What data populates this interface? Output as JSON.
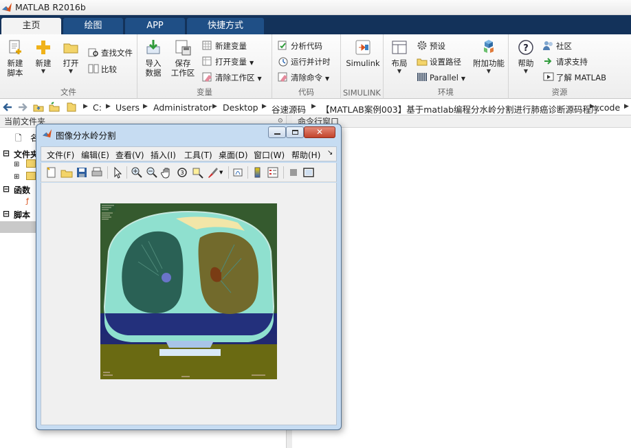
{
  "app": {
    "title": "MATLAB R2016b"
  },
  "tabs": [
    {
      "label": "主页",
      "active": true
    },
    {
      "label": "绘图"
    },
    {
      "label": "APP"
    },
    {
      "label": "快捷方式"
    }
  ],
  "ribbon": {
    "file": {
      "label": "文件",
      "new_script": "新建\n脚本",
      "new": "新建",
      "open": "打开",
      "find_files": "查找文件",
      "compare": "比较"
    },
    "variable": {
      "label": "变量",
      "import": "导入\n数据",
      "save_workspace": "保存\n工作区",
      "new_variable": "新建变量",
      "open_variable": "打开变量",
      "clear_workspace": "清除工作区"
    },
    "code": {
      "label": "代码",
      "analyze": "分析代码",
      "run_time": "运行并计时",
      "clear_commands": "清除命令"
    },
    "simulink": {
      "label": "SIMULINK",
      "simulink": "Simulink"
    },
    "environment": {
      "label": "环境",
      "layout": "布局",
      "preferences": "预设",
      "set_path": "设置路径",
      "parallel": "Parallel",
      "addons": "附加功能"
    },
    "resources": {
      "label": "资源",
      "help": "帮助",
      "community": "社区",
      "support": "请求支持",
      "learn": "了解 MATLAB"
    }
  },
  "path": [
    "C:",
    "Users",
    "Administrator",
    "Desktop",
    "谷速源码",
    "【MATLAB案例003】基于matlab编程分水岭分割进行肺癌诊断源码程序",
    "code"
  ],
  "left_panel": {
    "header": "当前文件夹",
    "col_name": "名",
    "sections": [
      "文件夹",
      "函数",
      "脚本"
    ]
  },
  "command_window": {
    "header": "命令行窗口"
  },
  "figure": {
    "title": "图像分水岭分割",
    "menu": [
      "文件(F)",
      "编辑(E)",
      "查看(V)",
      "插入(I)",
      "工具(T)",
      "桌面(D)",
      "窗口(W)",
      "帮助(H)"
    ]
  },
  "colors": {
    "tabbar": "#13325a",
    "tab": "#1f4f86",
    "window_frame": "#c6dcf2"
  }
}
